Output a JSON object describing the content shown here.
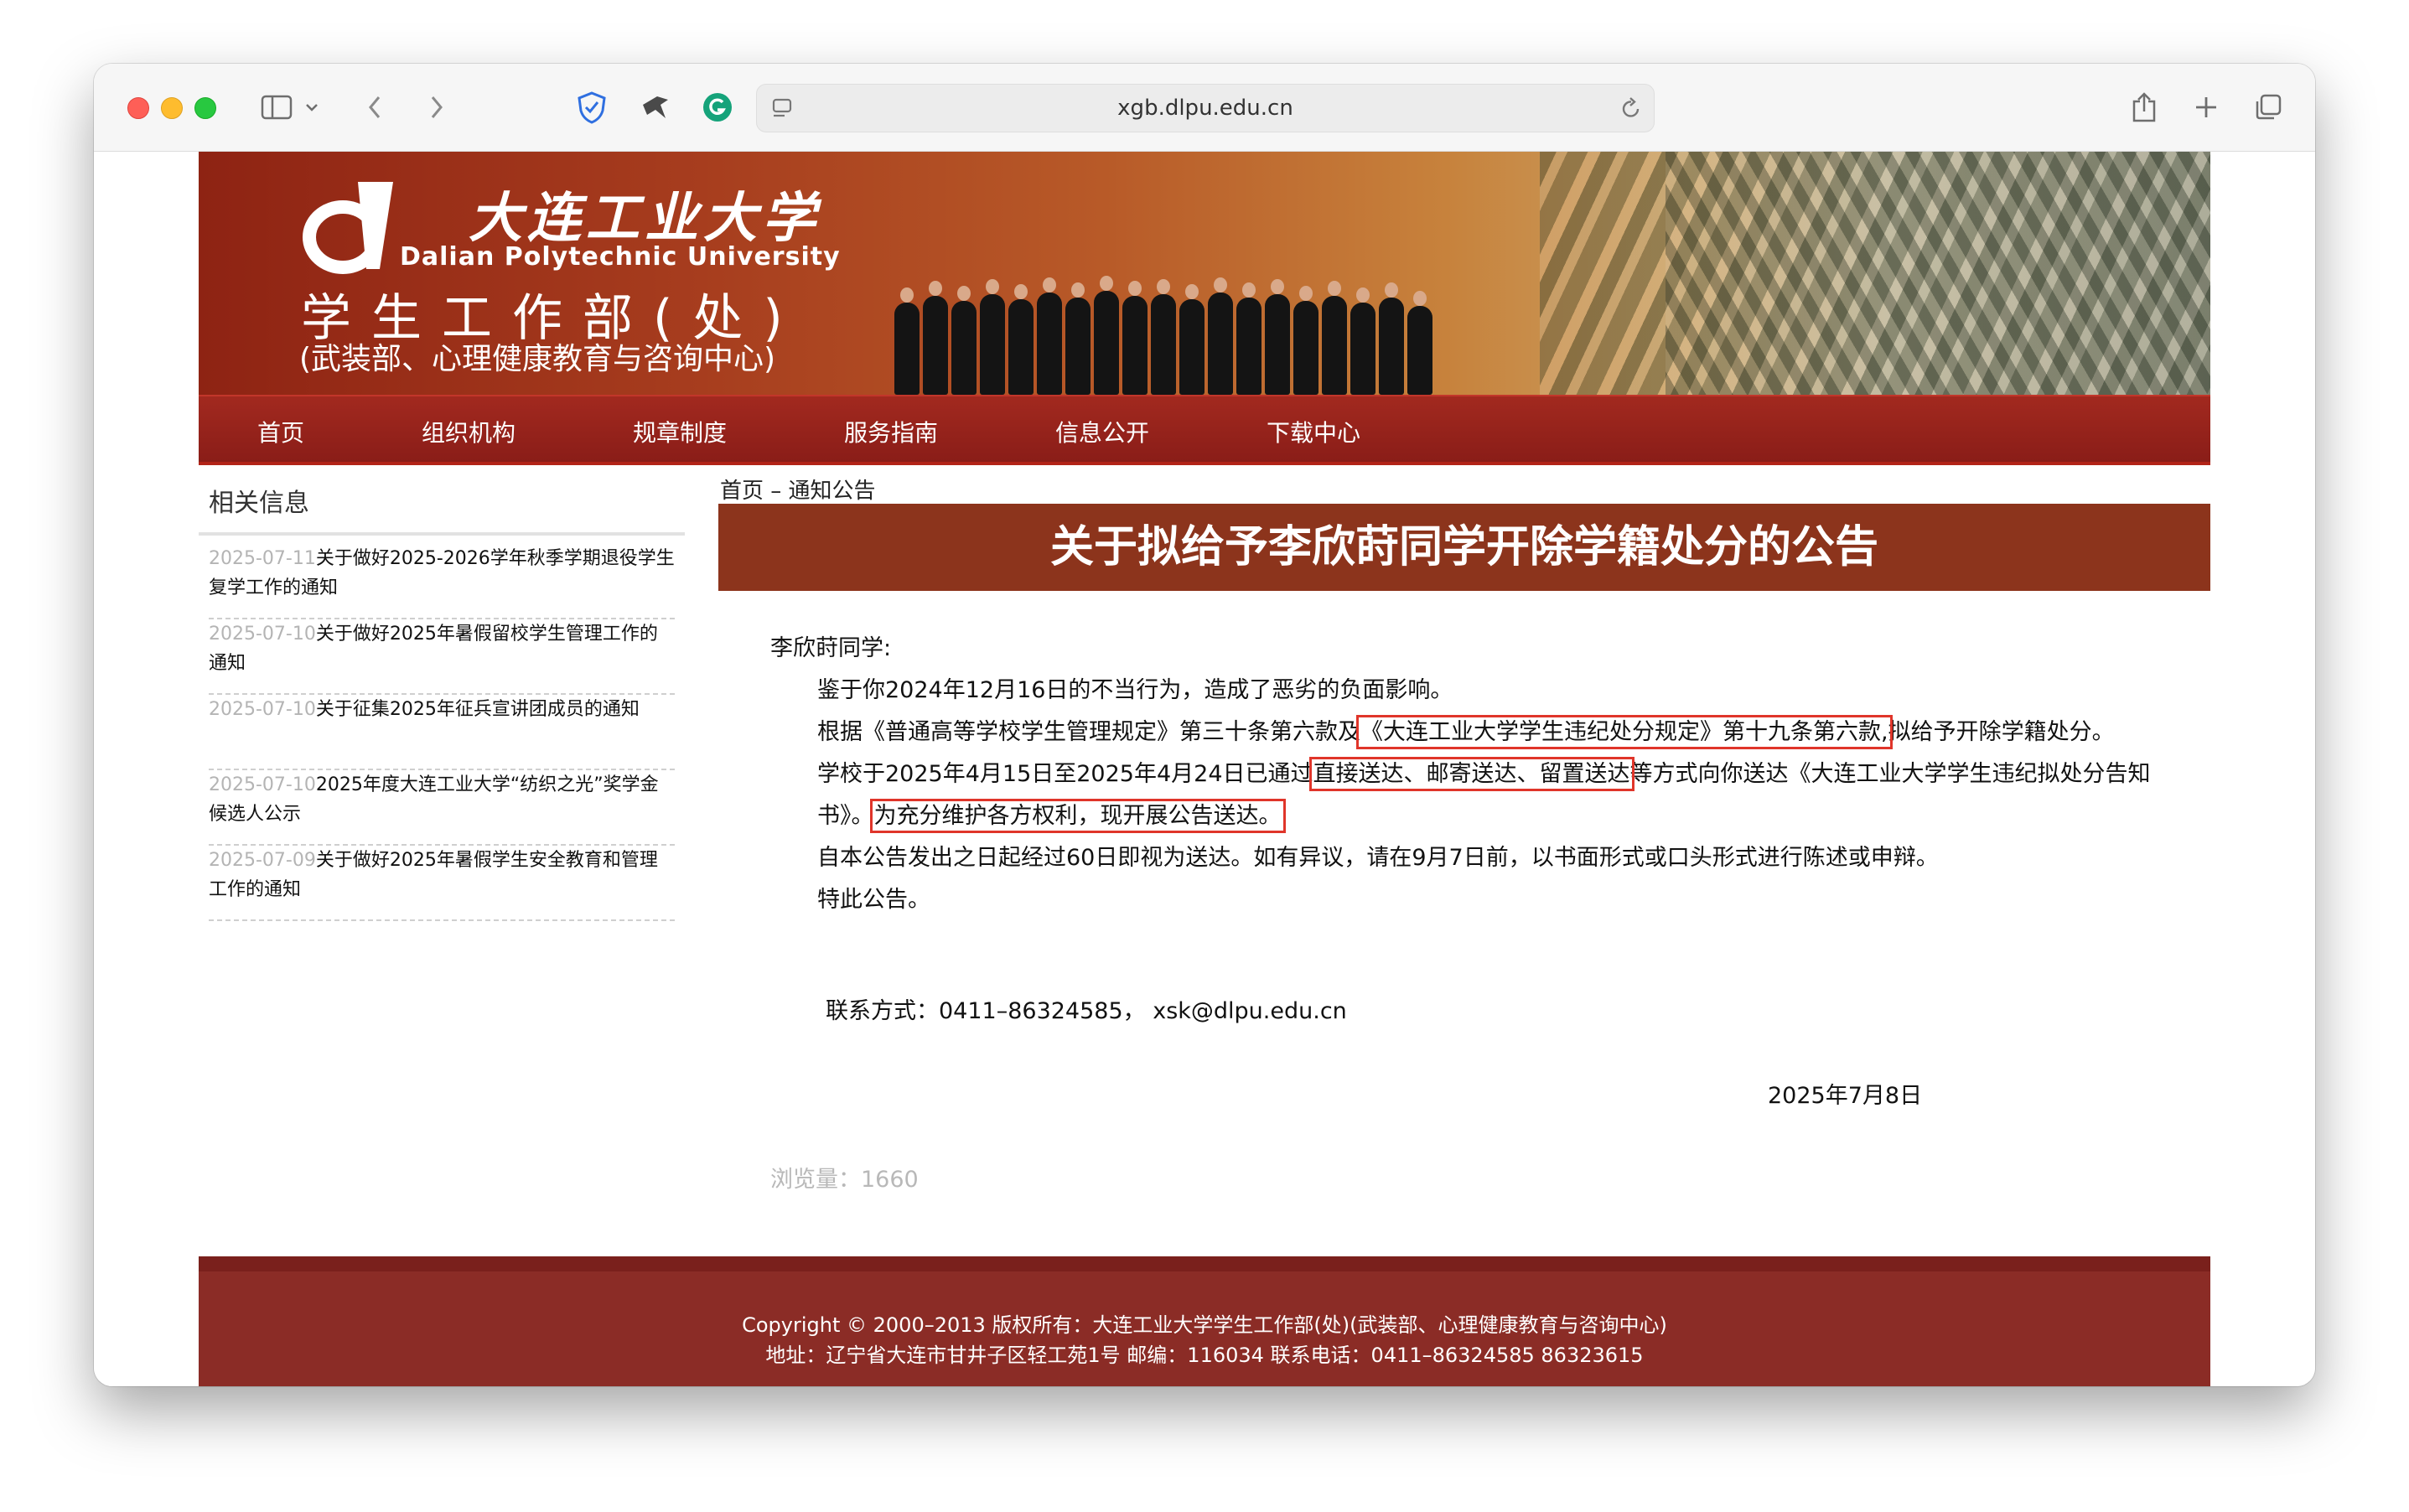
{
  "browser": {
    "url": "xgb.dlpu.edu.cn"
  },
  "banner": {
    "cn_name": "大连工业大学",
    "en_name": "Dalian Polytechnic University",
    "dept": "学生工作部(处)",
    "dept_sub": "(武装部、心理健康教育与咨询中心)"
  },
  "nav": [
    "首页",
    "组织机构",
    "规章制度",
    "服务指南",
    "信息公开",
    "下载中心"
  ],
  "sidebar": {
    "title": "相关信息",
    "items": [
      {
        "date": "2025-07-11",
        "text": "关于做好2025-2026学年秋季学期退役学生复学工作的通知"
      },
      {
        "date": "2025-07-10",
        "text": "关于做好2025年暑假留校学生管理工作的通知"
      },
      {
        "date": "2025-07-10",
        "text": "关于征集2025年征兵宣讲团成员的通知"
      },
      {
        "date": "2025-07-10",
        "text": "2025年度大连工业大学“纺织之光”奖学金候选人公示"
      },
      {
        "date": "2025-07-09",
        "text": "关于做好2025年暑假学生安全教育和管理工作的通知"
      }
    ]
  },
  "breadcrumb": "首页 – 通知公告",
  "article": {
    "title": "关于拟给予李欣莳同学开除学籍处分的公告",
    "salutation": "李欣莳同学:",
    "p1": "鉴于你2024年12月16日的不当行为，造成了恶劣的负面影响。",
    "p2_a": "根据《普通高等学校学生管理规定》第三十条第六款及",
    "p2_hl": "《大连工业大学学生违纪处分规定》第十九条第六款,",
    "p2_b": "拟给予开除学籍处分。",
    "p3_a": "学校于2025年4月15日至2025年4月24日已通过",
    "p3_hl1": "直接送达、邮寄送达、留置送达",
    "p3_b": "等方式向你送达《大连工业大学学生违纪拟处分告知书》。",
    "p3_hl2": "为充分维护各方权利，现开展公告送达。",
    "p4": "自本公告发出之日起经过60日即视为送达。如有异议，请在9月7日前，以书面形式或口头形式进行陈述或申辩。",
    "p5": "特此公告。",
    "contact": "联系方式：0411–86324585， xsk@dlpu.edu.cn",
    "date": "2025年7月8日",
    "views": "浏览量：1660"
  },
  "footer": {
    "line1": "Copyright © 2000–2013 版权所有：大连工业大学学生工作部(处)(武装部、心理健康教育与咨询中心)",
    "line2": "地址：辽宁省大连市甘井子区轻工苑1号 邮编：116034 联系电话：0411–86324585 86323615"
  }
}
